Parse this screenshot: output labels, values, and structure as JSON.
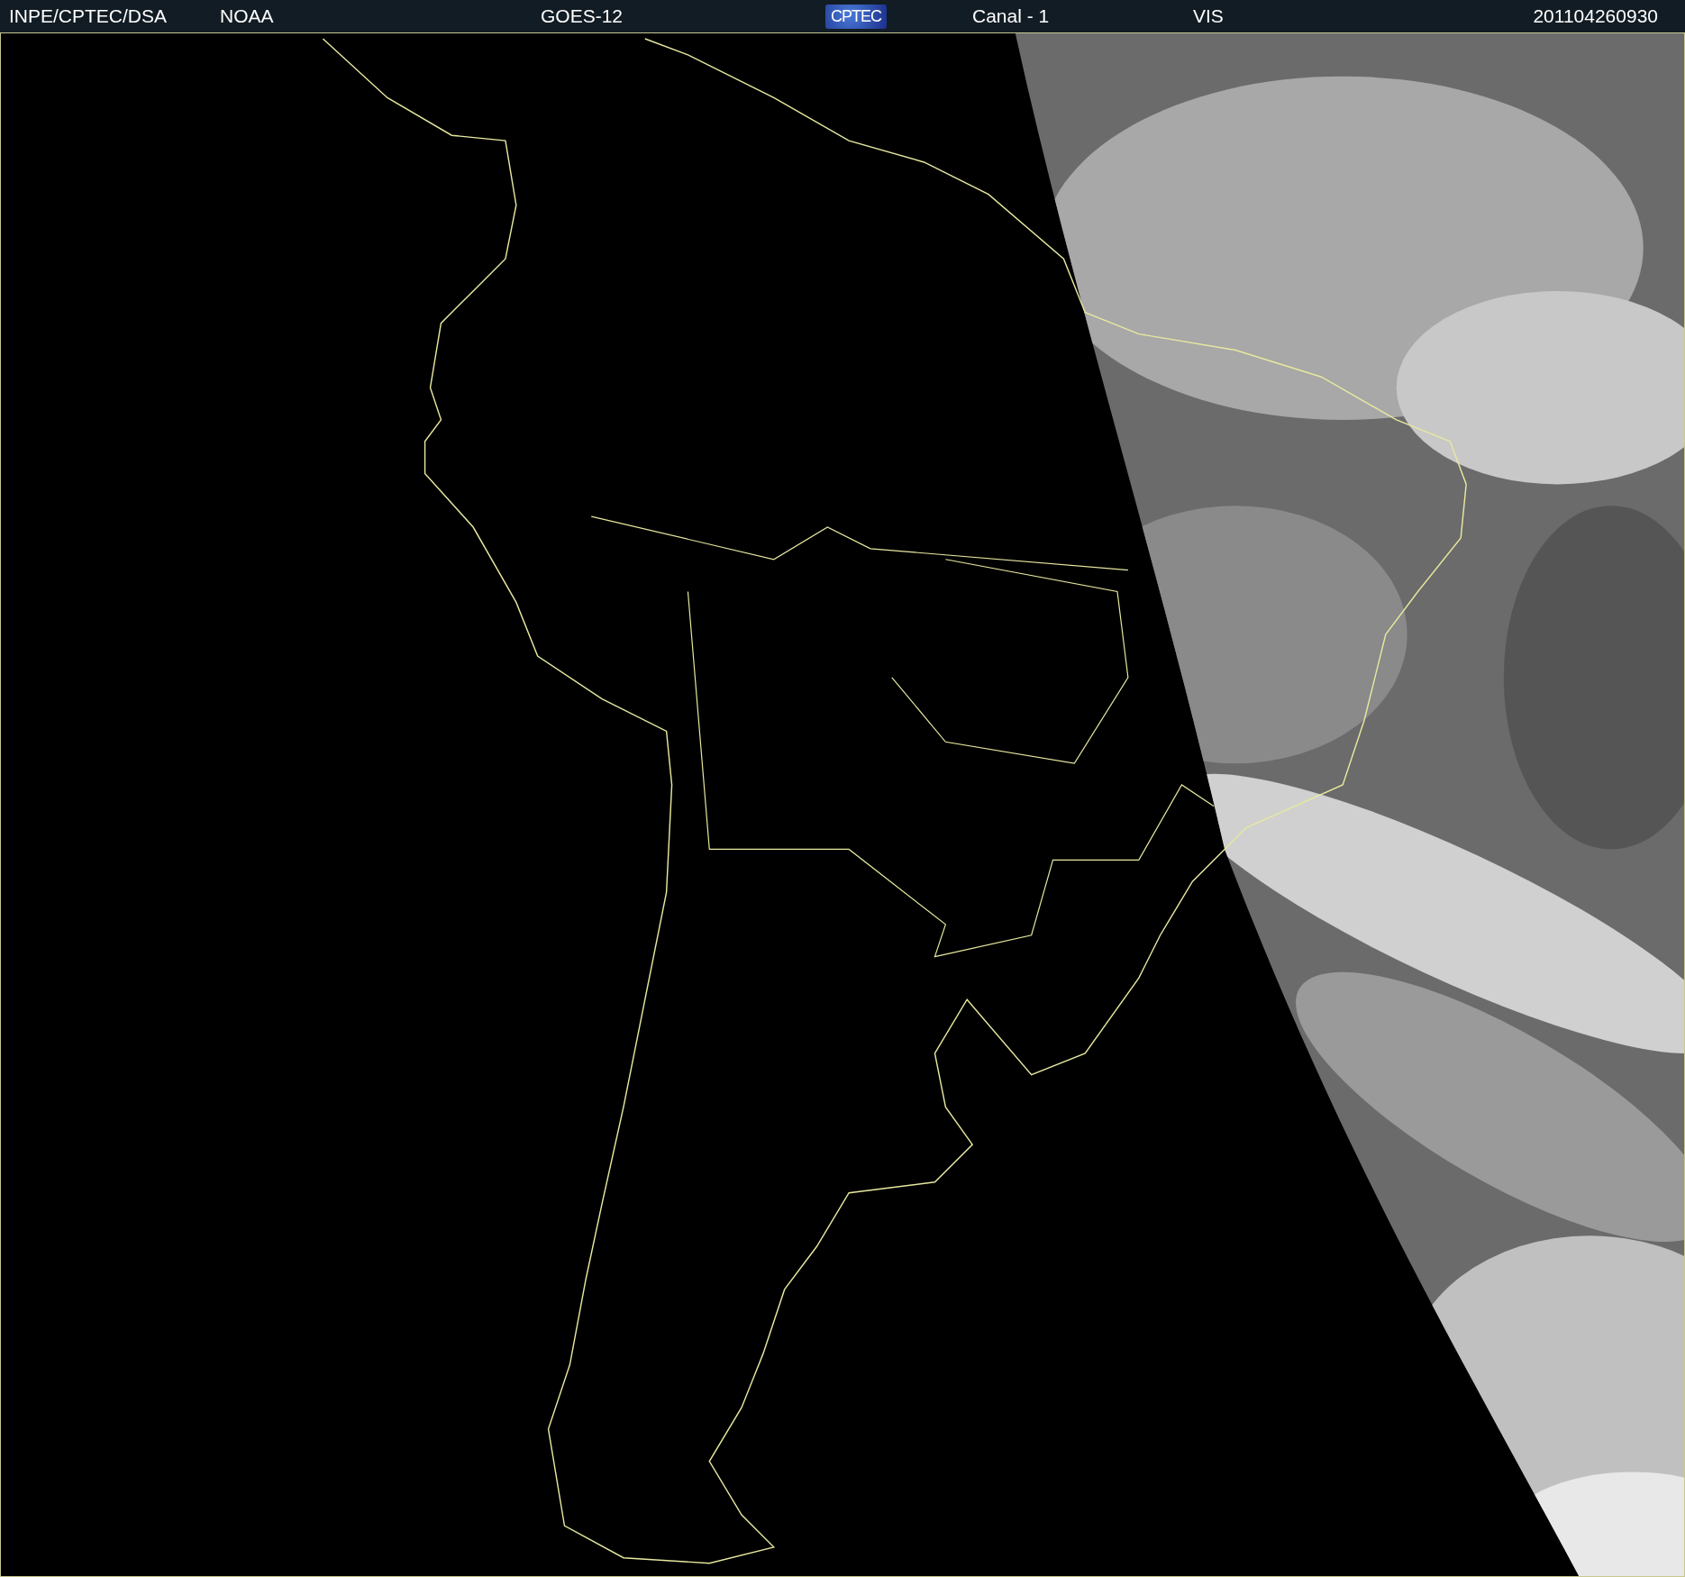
{
  "header": {
    "items": [
      {
        "kind": "text",
        "text": "INPE/CPTEC/DSA"
      },
      {
        "kind": "text",
        "text": "NOAA"
      },
      {
        "kind": "text",
        "text": "GOES-12"
      },
      {
        "kind": "logo",
        "text": "CPTEC"
      },
      {
        "kind": "text",
        "text": "Canal - 1"
      },
      {
        "kind": "text",
        "text": "VIS"
      },
      {
        "kind": "text",
        "text": "201104260930"
      }
    ]
  }
}
